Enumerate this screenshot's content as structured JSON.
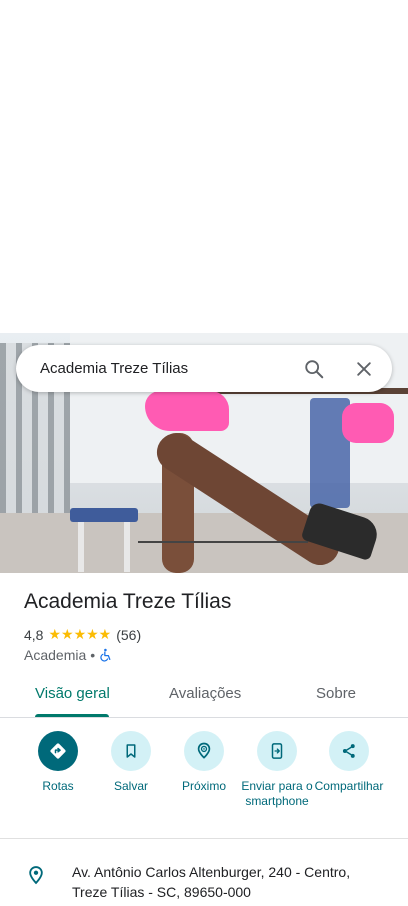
{
  "search": {
    "query": "Academia Treze Tílias"
  },
  "place": {
    "name": "Academia Treze Tílias",
    "rating": "4,8",
    "stars": "★★★★★",
    "reviews_count": "(56)",
    "category": "Academia",
    "separator": "•"
  },
  "tabs": [
    {
      "label": "Visão geral",
      "active": true
    },
    {
      "label": "Avaliações",
      "active": false
    },
    {
      "label": "Sobre",
      "active": false
    }
  ],
  "actions": [
    {
      "label": "Rotas",
      "icon": "directions-icon"
    },
    {
      "label": "Salvar",
      "icon": "bookmark-icon"
    },
    {
      "label": "Próximo",
      "icon": "nearby-icon"
    },
    {
      "label": "Enviar para o smartphone",
      "icon": "send-to-phone-icon"
    },
    {
      "label": "Compartilhar",
      "icon": "share-icon"
    }
  ],
  "address": {
    "text": "Av. Antônio Carlos Altenburger, 240 - Centro, Treze Tílias - SC, 89650-000"
  },
  "colors": {
    "accent": "#00796b",
    "action_bg": "#d3f1f6",
    "primary_action": "#00697a",
    "star": "#fbbc04"
  }
}
